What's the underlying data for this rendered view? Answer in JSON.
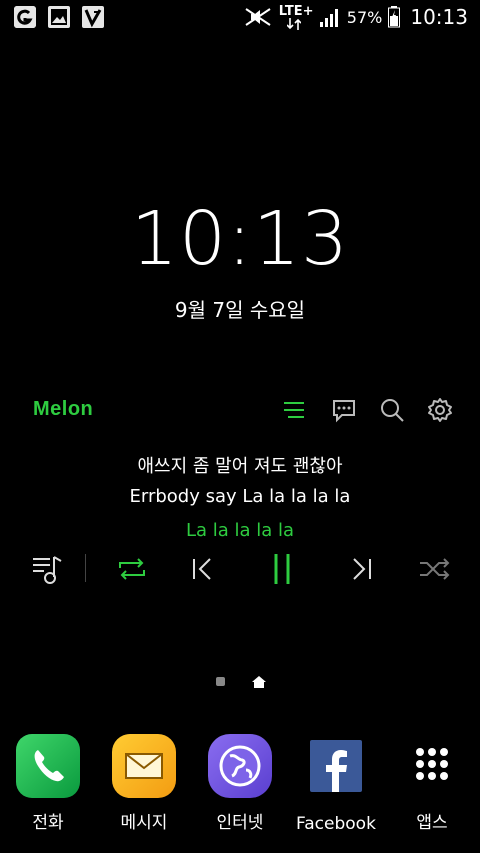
{
  "status_bar": {
    "left_icons": [
      "gallery-notification-icon",
      "image-notification-icon",
      "app-notification-icon"
    ],
    "network": "LTE+",
    "battery_percent": "57%",
    "time": "10:13"
  },
  "lockscreen": {
    "clock": "10:13",
    "date": "9월 7일 수요일"
  },
  "melon": {
    "logo": "Melon",
    "lyrics": {
      "line1": "애쓰지 좀 말어 져도 괜찮아",
      "line2": "Errbody say La la la la la",
      "current": "La la la la la"
    },
    "colors": {
      "accent": "#2ecc40"
    }
  },
  "dock": [
    {
      "label": "전화",
      "icon": "phone-icon"
    },
    {
      "label": "메시지",
      "icon": "envelope-icon"
    },
    {
      "label": "인터넷",
      "icon": "globe-icon"
    },
    {
      "label": "Facebook",
      "icon": "facebook-icon"
    },
    {
      "label": "앱스",
      "icon": "apps-grid-icon"
    }
  ]
}
